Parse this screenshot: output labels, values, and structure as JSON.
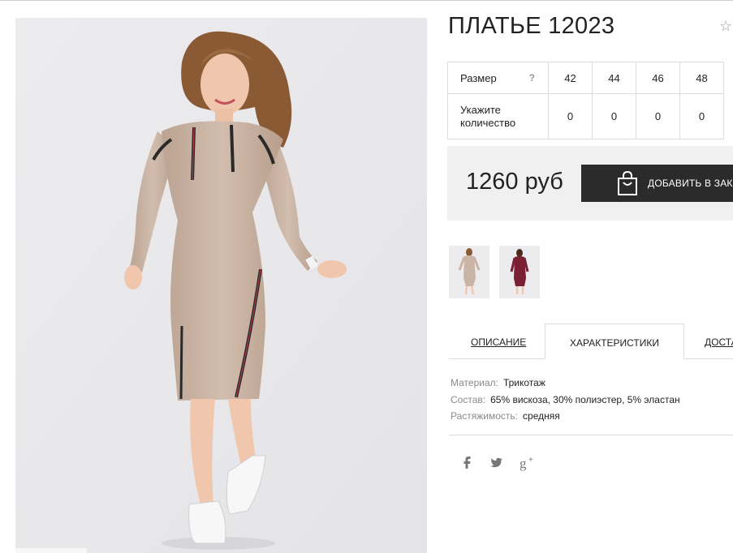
{
  "product": {
    "title": "ПЛАТЬЕ 12023",
    "favorite_icon": "star-outline-icon"
  },
  "size_table": {
    "size_label": "Размер",
    "help_mark": "?",
    "sizes": [
      "42",
      "44",
      "46",
      "48"
    ],
    "quantity_label": "Укажите количество",
    "quantities": [
      "0",
      "0",
      "0",
      "0"
    ]
  },
  "purchase": {
    "price": "1260 руб",
    "add_button_label": "ДОБАВИТЬ В ЗАКАЗ",
    "button_icon": "shopping-bag-icon"
  },
  "thumbnails": [
    {
      "name": "beige-dress-thumbnail",
      "color": "#c9b4a6"
    },
    {
      "name": "burgundy-dress-thumbnail",
      "color": "#7b1f35"
    }
  ],
  "tabs": [
    {
      "label": "ОПИСАНИЕ",
      "active": false
    },
    {
      "label": "ХАРАКТЕРИСТИКИ",
      "active": true
    },
    {
      "label": "ДОСТАВКА",
      "active": false
    }
  ],
  "characteristics": [
    {
      "key": "Материал:",
      "value": "Трикотаж"
    },
    {
      "key": "Состав:",
      "value": "65% вискоза, 30% полиэстер, 5% эластан"
    },
    {
      "key": "Растяжимость:",
      "value": "средняя"
    }
  ],
  "social": [
    {
      "icon": "facebook-icon"
    },
    {
      "icon": "twitter-icon"
    },
    {
      "icon": "google-plus-icon"
    }
  ],
  "colors": {
    "button_bg": "#2b2b2b",
    "price_box_bg": "#f0f0f0",
    "dress_beige": "#c9b4a6",
    "dress_burgundy": "#7b1f35"
  }
}
